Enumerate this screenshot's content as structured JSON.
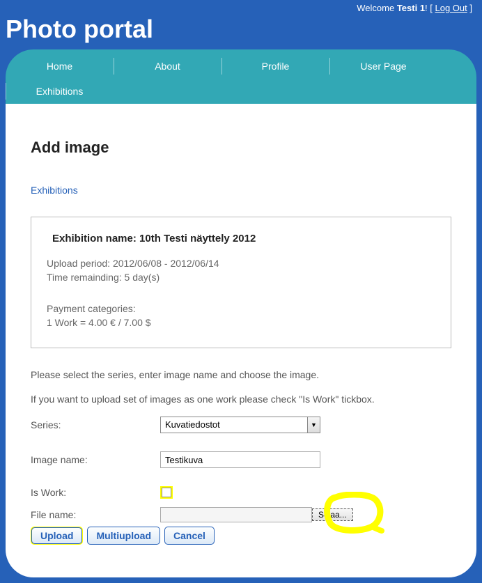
{
  "header": {
    "welcome_prefix": "Welcome ",
    "username": "Testi 1",
    "welcome_suffix": "! [ ",
    "logout": "Log Out",
    "welcome_end": " ]",
    "site_title": "Photo portal"
  },
  "nav": {
    "home": "Home",
    "about": "About",
    "profile": "Profile",
    "user_page": "User Page",
    "exhibitions": "Exhibitions"
  },
  "page": {
    "title": "Add image",
    "exhibitions_link": "Exhibitions"
  },
  "info": {
    "name_label": "Exhibition name: ",
    "name_value": "10th Testi näyttely 2012",
    "upload_period_label": "Upload period: ",
    "upload_period_value": "2012/06/08 - 2012/06/14",
    "time_remaining_label": "Time remainding: ",
    "time_remaining_value": "5 day(s)",
    "payment_label": "Payment categories:",
    "payment_line": "1 Work = 4.00 € / 7.00 $"
  },
  "instructions": {
    "line1": "Please select the series, enter image name and choose the image.",
    "line2": "If you want to upload set of images as one work please check \"Is Work\" tickbox."
  },
  "form": {
    "series_label": "Series:",
    "series_value": "Kuvatiedostot",
    "image_name_label": "Image name:",
    "image_name_value": "Testikuva",
    "is_work_label": "Is Work:",
    "file_name_label": "File name:",
    "browse_button": "Selaa..."
  },
  "buttons": {
    "upload": "Upload",
    "multiupload": "Multiupload",
    "cancel": "Cancel"
  }
}
